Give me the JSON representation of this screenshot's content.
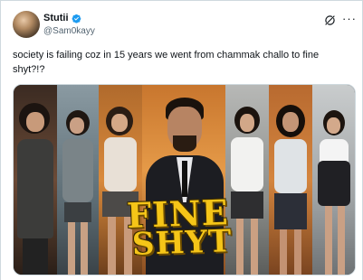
{
  "author": {
    "display_name": "Stutii",
    "handle": "@Sam0kayy",
    "verified": true,
    "avatar_icon": "avatar"
  },
  "actions": {
    "grok_icon": "grok-icon",
    "more_icon": "more-icon",
    "more_glyph": "···"
  },
  "tweet": {
    "text": "society is failing coz in 15 years we went from chammak challo to fine shyt?!?"
  },
  "media": {
    "logo_line1": "FINE",
    "logo_line2": "SHYT"
  },
  "colors": {
    "verified_blue": "#1d9bf0",
    "logo_yellow": "#f5c518"
  }
}
